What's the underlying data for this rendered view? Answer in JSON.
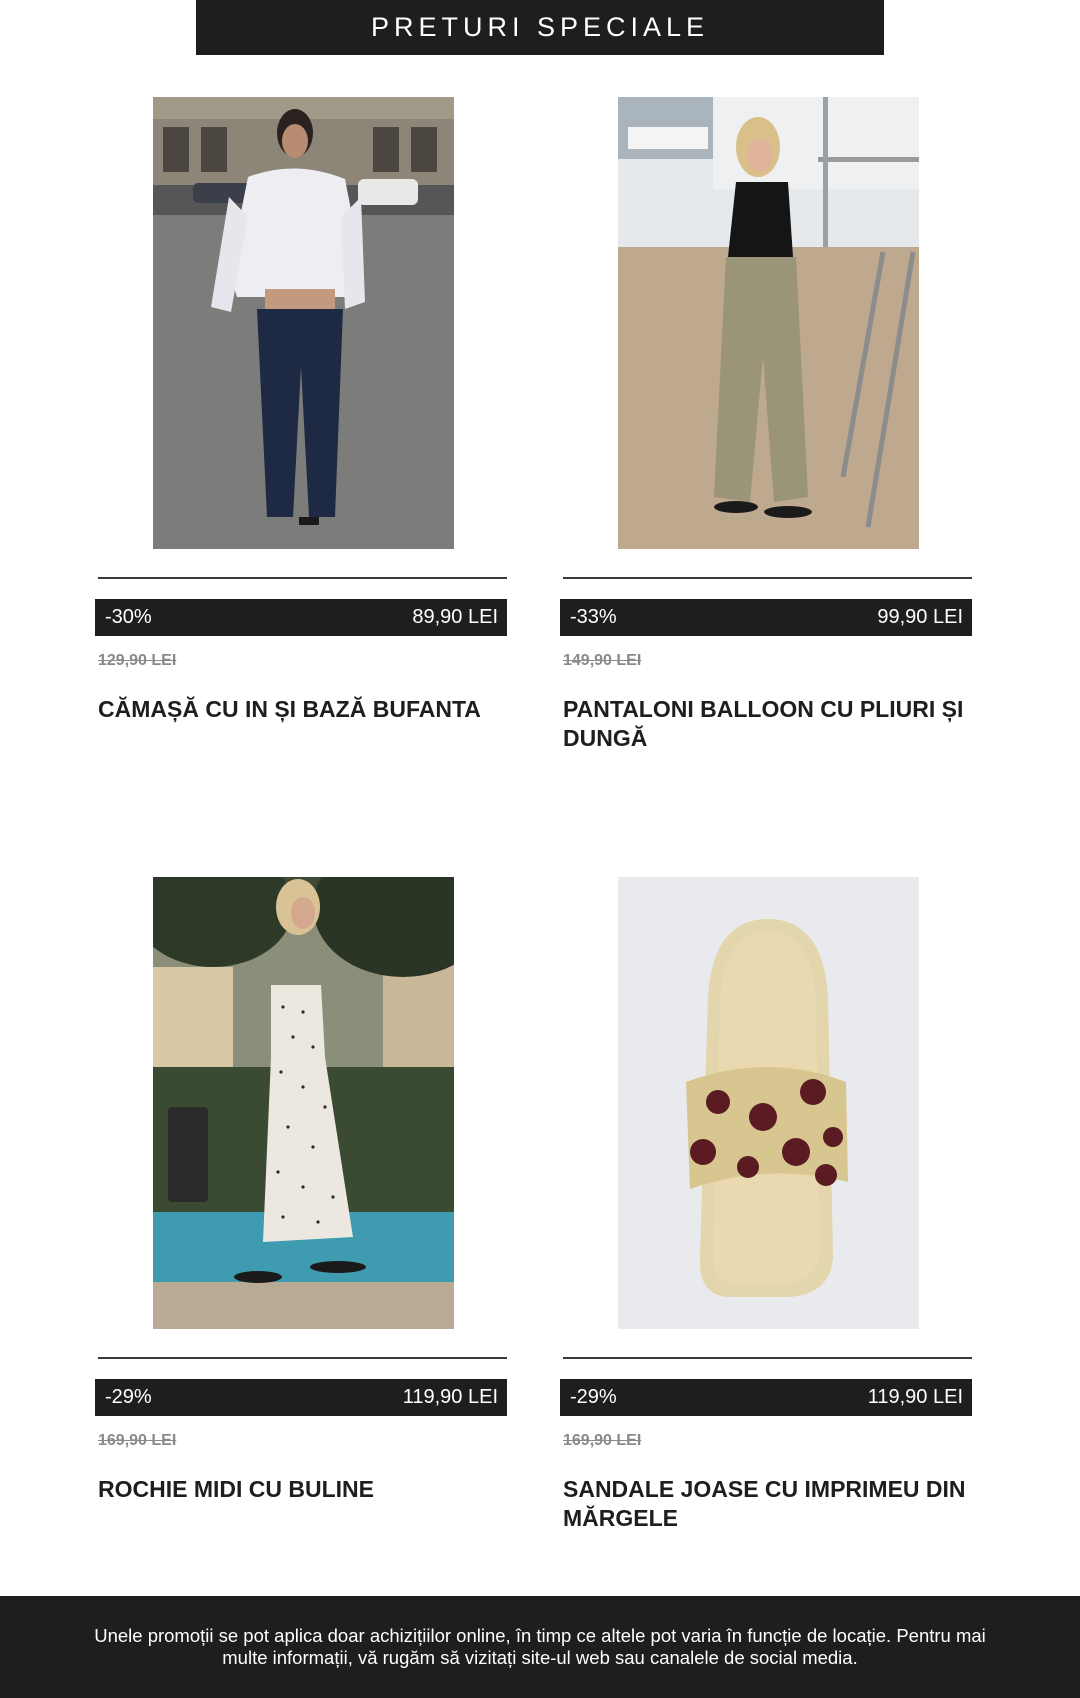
{
  "banner": {
    "title": "PRETURI SPECIALE"
  },
  "products": [
    {
      "discount": "-30%",
      "price": "89,90 LEI",
      "old_price": "129,90 LEI",
      "title": "CĂMAȘĂ CU IN ȘI BAZĂ BUFANTA",
      "image": "woman-white-shirt-navy-trousers-street-photo"
    },
    {
      "discount": "-33%",
      "price": "99,90 LEI",
      "old_price": "149,90 LEI",
      "title": "PANTALONI BALLOON CU PLIURI ȘI DUNGĂ",
      "image": "woman-black-top-khaki-trousers-beach-photo"
    },
    {
      "discount": "-29%",
      "price": "119,90 LEI",
      "old_price": "169,90 LEI",
      "title": "ROCHIE MIDI CU BULINE",
      "image": "woman-polka-dot-dress-fountain-photo"
    },
    {
      "discount": "-29%",
      "price": "119,90 LEI",
      "old_price": "169,90 LEI",
      "title": "SANDALE JOASE CU IMPRIMEU DIN MĂRGELE",
      "image": "beaded-polka-dot-sandal-photo"
    }
  ],
  "footer": {
    "text": "Unele promoții se pot aplica doar achizițiilor online, în timp ce altele pot varia în funcție de locație. Pentru mai multe informații, vă rugăm să vizitați site-ul web sau canalele de social media."
  }
}
